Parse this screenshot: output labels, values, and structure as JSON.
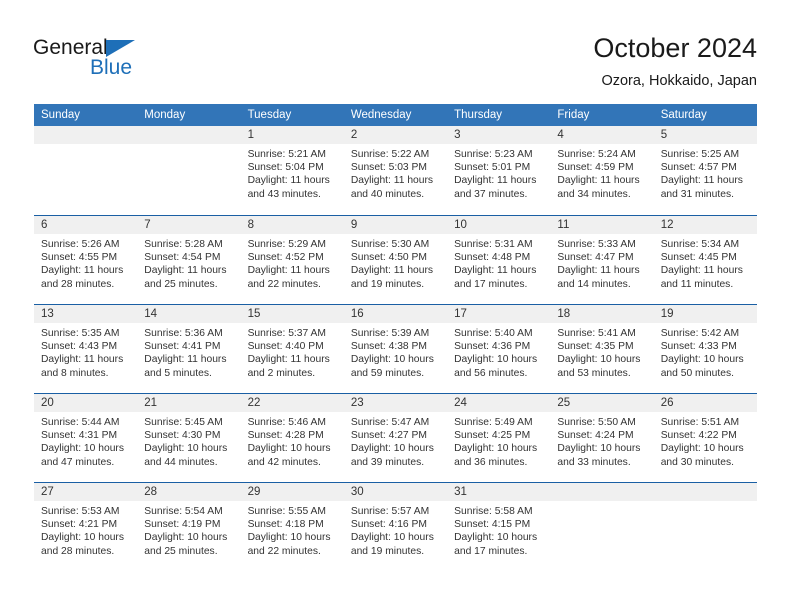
{
  "brand": {
    "name_part1": "General",
    "name_part2": "Blue",
    "triangle_color": "#1e6fb8"
  },
  "header": {
    "title": "October 2024",
    "subtitle": "Ozora, Hokkaido, Japan"
  },
  "theme": {
    "header_blue": "#3275b8",
    "separator_blue": "#1a5fa4",
    "daynum_gray": "#f0f0f0"
  },
  "weekdays": [
    "Sunday",
    "Monday",
    "Tuesday",
    "Wednesday",
    "Thursday",
    "Friday",
    "Saturday"
  ],
  "weeks": [
    [
      {
        "day": "",
        "empty": true
      },
      {
        "day": "",
        "empty": true
      },
      {
        "day": "1",
        "sunrise": "Sunrise: 5:21 AM",
        "sunset": "Sunset: 5:04 PM",
        "daylight": "Daylight: 11 hours and 43 minutes."
      },
      {
        "day": "2",
        "sunrise": "Sunrise: 5:22 AM",
        "sunset": "Sunset: 5:03 PM",
        "daylight": "Daylight: 11 hours and 40 minutes."
      },
      {
        "day": "3",
        "sunrise": "Sunrise: 5:23 AM",
        "sunset": "Sunset: 5:01 PM",
        "daylight": "Daylight: 11 hours and 37 minutes."
      },
      {
        "day": "4",
        "sunrise": "Sunrise: 5:24 AM",
        "sunset": "Sunset: 4:59 PM",
        "daylight": "Daylight: 11 hours and 34 minutes."
      },
      {
        "day": "5",
        "sunrise": "Sunrise: 5:25 AM",
        "sunset": "Sunset: 4:57 PM",
        "daylight": "Daylight: 11 hours and 31 minutes."
      }
    ],
    [
      {
        "day": "6",
        "sunrise": "Sunrise: 5:26 AM",
        "sunset": "Sunset: 4:55 PM",
        "daylight": "Daylight: 11 hours and 28 minutes."
      },
      {
        "day": "7",
        "sunrise": "Sunrise: 5:28 AM",
        "sunset": "Sunset: 4:54 PM",
        "daylight": "Daylight: 11 hours and 25 minutes."
      },
      {
        "day": "8",
        "sunrise": "Sunrise: 5:29 AM",
        "sunset": "Sunset: 4:52 PM",
        "daylight": "Daylight: 11 hours and 22 minutes."
      },
      {
        "day": "9",
        "sunrise": "Sunrise: 5:30 AM",
        "sunset": "Sunset: 4:50 PM",
        "daylight": "Daylight: 11 hours and 19 minutes."
      },
      {
        "day": "10",
        "sunrise": "Sunrise: 5:31 AM",
        "sunset": "Sunset: 4:48 PM",
        "daylight": "Daylight: 11 hours and 17 minutes."
      },
      {
        "day": "11",
        "sunrise": "Sunrise: 5:33 AM",
        "sunset": "Sunset: 4:47 PM",
        "daylight": "Daylight: 11 hours and 14 minutes."
      },
      {
        "day": "12",
        "sunrise": "Sunrise: 5:34 AM",
        "sunset": "Sunset: 4:45 PM",
        "daylight": "Daylight: 11 hours and 11 minutes."
      }
    ],
    [
      {
        "day": "13",
        "sunrise": "Sunrise: 5:35 AM",
        "sunset": "Sunset: 4:43 PM",
        "daylight": "Daylight: 11 hours and 8 minutes."
      },
      {
        "day": "14",
        "sunrise": "Sunrise: 5:36 AM",
        "sunset": "Sunset: 4:41 PM",
        "daylight": "Daylight: 11 hours and 5 minutes."
      },
      {
        "day": "15",
        "sunrise": "Sunrise: 5:37 AM",
        "sunset": "Sunset: 4:40 PM",
        "daylight": "Daylight: 11 hours and 2 minutes."
      },
      {
        "day": "16",
        "sunrise": "Sunrise: 5:39 AM",
        "sunset": "Sunset: 4:38 PM",
        "daylight": "Daylight: 10 hours and 59 minutes."
      },
      {
        "day": "17",
        "sunrise": "Sunrise: 5:40 AM",
        "sunset": "Sunset: 4:36 PM",
        "daylight": "Daylight: 10 hours and 56 minutes."
      },
      {
        "day": "18",
        "sunrise": "Sunrise: 5:41 AM",
        "sunset": "Sunset: 4:35 PM",
        "daylight": "Daylight: 10 hours and 53 minutes."
      },
      {
        "day": "19",
        "sunrise": "Sunrise: 5:42 AM",
        "sunset": "Sunset: 4:33 PM",
        "daylight": "Daylight: 10 hours and 50 minutes."
      }
    ],
    [
      {
        "day": "20",
        "sunrise": "Sunrise: 5:44 AM",
        "sunset": "Sunset: 4:31 PM",
        "daylight": "Daylight: 10 hours and 47 minutes."
      },
      {
        "day": "21",
        "sunrise": "Sunrise: 5:45 AM",
        "sunset": "Sunset: 4:30 PM",
        "daylight": "Daylight: 10 hours and 44 minutes."
      },
      {
        "day": "22",
        "sunrise": "Sunrise: 5:46 AM",
        "sunset": "Sunset: 4:28 PM",
        "daylight": "Daylight: 10 hours and 42 minutes."
      },
      {
        "day": "23",
        "sunrise": "Sunrise: 5:47 AM",
        "sunset": "Sunset: 4:27 PM",
        "daylight": "Daylight: 10 hours and 39 minutes."
      },
      {
        "day": "24",
        "sunrise": "Sunrise: 5:49 AM",
        "sunset": "Sunset: 4:25 PM",
        "daylight": "Daylight: 10 hours and 36 minutes."
      },
      {
        "day": "25",
        "sunrise": "Sunrise: 5:50 AM",
        "sunset": "Sunset: 4:24 PM",
        "daylight": "Daylight: 10 hours and 33 minutes."
      },
      {
        "day": "26",
        "sunrise": "Sunrise: 5:51 AM",
        "sunset": "Sunset: 4:22 PM",
        "daylight": "Daylight: 10 hours and 30 minutes."
      }
    ],
    [
      {
        "day": "27",
        "sunrise": "Sunrise: 5:53 AM",
        "sunset": "Sunset: 4:21 PM",
        "daylight": "Daylight: 10 hours and 28 minutes."
      },
      {
        "day": "28",
        "sunrise": "Sunrise: 5:54 AM",
        "sunset": "Sunset: 4:19 PM",
        "daylight": "Daylight: 10 hours and 25 minutes."
      },
      {
        "day": "29",
        "sunrise": "Sunrise: 5:55 AM",
        "sunset": "Sunset: 4:18 PM",
        "daylight": "Daylight: 10 hours and 22 minutes."
      },
      {
        "day": "30",
        "sunrise": "Sunrise: 5:57 AM",
        "sunset": "Sunset: 4:16 PM",
        "daylight": "Daylight: 10 hours and 19 minutes."
      },
      {
        "day": "31",
        "sunrise": "Sunrise: 5:58 AM",
        "sunset": "Sunset: 4:15 PM",
        "daylight": "Daylight: 10 hours and 17 minutes."
      },
      {
        "day": "",
        "empty": true
      },
      {
        "day": "",
        "empty": true
      }
    ]
  ]
}
